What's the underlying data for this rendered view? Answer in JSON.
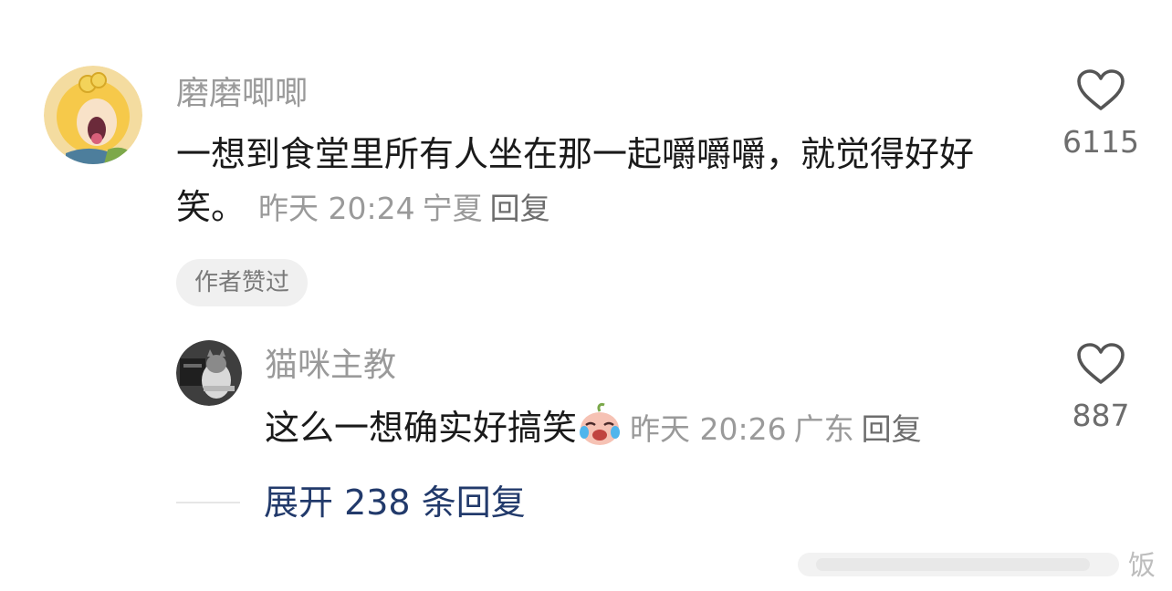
{
  "comment": {
    "username": "磨磨唧唧",
    "content": "一想到食堂里所有人坐在那一起嚼嚼嚼，就觉得好好笑。",
    "time": "昨天 20:24",
    "location": "宁夏",
    "reply_label": "回复",
    "like_count": "6115",
    "author_badge": "作者赞过"
  },
  "reply": {
    "username": "猫咪主教",
    "content": "这么一想确实好搞笑",
    "emoji": "laughing-crying-peach-emoji",
    "time": "昨天 20:26",
    "location": "广东",
    "reply_label": "回复",
    "like_count": "887"
  },
  "expand": {
    "label": "展开 238 条回复"
  },
  "watermark": {
    "text": "饭"
  },
  "colors": {
    "username": "#9a9a9a",
    "text": "#1a1a1a",
    "link": "#223a6b",
    "badge_bg": "#f0f0f0"
  }
}
